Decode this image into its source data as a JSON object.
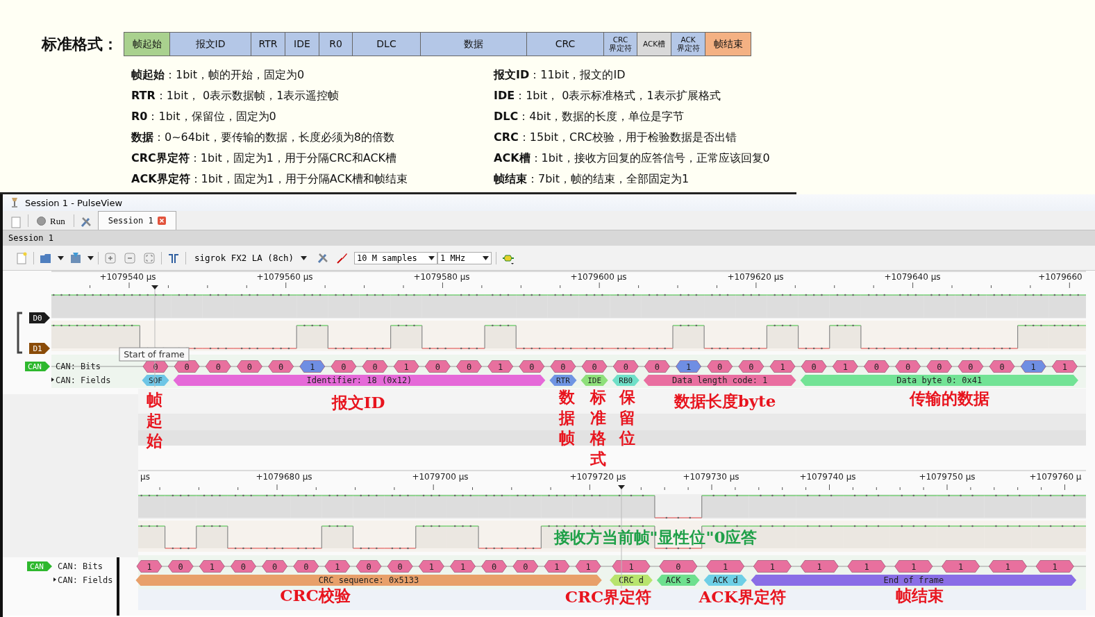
{
  "frame_format": {
    "title": "标准格式：",
    "fields": [
      {
        "lines": [
          "帧起始"
        ],
        "kind": "normal",
        "color": "#a9d18e"
      },
      {
        "lines": [
          "报文ID"
        ],
        "kind": "normal",
        "color": "#b4c7e7"
      },
      {
        "lines": [
          "RTR"
        ],
        "kind": "normal",
        "color": "#b4c7e7"
      },
      {
        "lines": [
          "IDE"
        ],
        "kind": "normal",
        "color": "#b4c7e7"
      },
      {
        "lines": [
          "R0"
        ],
        "kind": "normal",
        "color": "#b4c7e7"
      },
      {
        "lines": [
          "DLC"
        ],
        "kind": "normal",
        "color": "#b4c7e7"
      },
      {
        "lines": [
          "数据"
        ],
        "kind": "normal",
        "color": "#b4c7e7"
      },
      {
        "lines": [
          "CRC"
        ],
        "kind": "normal",
        "color": "#b4c7e7"
      },
      {
        "lines": [
          "CRC",
          "界定符"
        ],
        "kind": "small",
        "color": "#b4c7e7"
      },
      {
        "lines": [
          "ACK槽"
        ],
        "kind": "small",
        "color": "#d9d9d9"
      },
      {
        "lines": [
          "ACK",
          "界定符"
        ],
        "kind": "small",
        "color": "#b4c7e7"
      },
      {
        "lines": [
          "帧结束"
        ],
        "kind": "normal",
        "color": "#f4b183"
      }
    ],
    "descriptions": [
      {
        "left": "**帧起始**：1bit，帧的开始，固定为0",
        "right": "**报文ID**：11bit，报文的ID"
      },
      {
        "left": "**RTR**：1bit， 0表示数据帧，1表示遥控帧",
        "right": "**IDE**：1bit， 0表示标准格式，1表示扩展格式"
      },
      {
        "left": "**R0**：1bit，保留位，固定为0",
        "right": "**DLC**：4bit，数据的长度，单位是字节"
      },
      {
        "left": "**数据**：0~64bit，要传输的数据，长度必须为8的倍数",
        "right": "**CRC**：15bit，CRC校验，用于检验数据是否出错"
      },
      {
        "left": "**CRC界定符**：1bit，固定为1，用于分隔CRC和ACK槽",
        "right": "**ACK槽**：1bit，接收方回复的应答信号，正常应该回复0"
      },
      {
        "left": "**ACK界定符**：1bit，固定为1，用于分隔ACK槽和帧结束",
        "right": "**帧结束**：7bit，帧的结束，全部固定为1"
      }
    ]
  },
  "window": {
    "title": "Session 1 - PulseView",
    "run_label": "Run",
    "tabs": [
      {
        "label": "Session 1",
        "selected": true
      }
    ],
    "session_label": "Session 1",
    "toolbar": {
      "device": "sigrok FX2 LA (8ch)",
      "samples": "10 M samples",
      "rate": "1 MHz"
    }
  },
  "views": [
    {
      "ruler": [
        "+1079540 µs",
        "+1079560 µs",
        "+1079580 µs",
        "+1079600 µs",
        "+1079620 µs",
        "+1079640 µs",
        "+1079660"
      ],
      "channels": [
        {
          "label": "D0",
          "color": "#1c1c1c"
        },
        {
          "label": "D1",
          "color": "#8a4b08"
        }
      ],
      "decoder": {
        "label": "CAN",
        "rows": [
          "CAN: Bits",
          "CAN: Fields"
        ]
      },
      "leading_idle": true,
      "fields": [
        {
          "label": "SOF",
          "color": "#6ec6e6",
          "bits": [
            {
              "value": "0",
              "kind": "data"
            }
          ]
        },
        {
          "label": "Identifier: 18 (0x12)",
          "color": "#e56ad8",
          "bits": [
            {
              "value": "0",
              "kind": "data"
            },
            {
              "value": "0",
              "kind": "data"
            },
            {
              "value": "0",
              "kind": "data"
            },
            {
              "value": "0",
              "kind": "data"
            },
            {
              "value": "1",
              "kind": "stuff"
            },
            {
              "value": "0",
              "kind": "data"
            },
            {
              "value": "0",
              "kind": "data"
            },
            {
              "value": "1",
              "kind": "data"
            },
            {
              "value": "0",
              "kind": "data"
            },
            {
              "value": "0",
              "kind": "data"
            },
            {
              "value": "1",
              "kind": "data"
            },
            {
              "value": "0",
              "kind": "data"
            }
          ]
        },
        {
          "label": "RTR",
          "color": "#6f95e3",
          "bits": [
            {
              "value": "0",
              "kind": "data"
            }
          ]
        },
        {
          "label": "IDE",
          "color": "#8ee07a",
          "bits": [
            {
              "value": "0",
              "kind": "data"
            }
          ]
        },
        {
          "label": "RB0",
          "color": "#6fe0c8",
          "bits": [
            {
              "value": "0",
              "kind": "data"
            }
          ]
        },
        {
          "label": "Data length code: 1",
          "color": "#e96fa0",
          "bits": [
            {
              "value": "0",
              "kind": "data"
            },
            {
              "value": "1",
              "kind": "stuff"
            },
            {
              "value": "0",
              "kind": "data"
            },
            {
              "value": "0",
              "kind": "data"
            },
            {
              "value": "1",
              "kind": "data"
            }
          ]
        },
        {
          "label": "Data byte 0: 0x41",
          "color": "#72e395",
          "bits": [
            {
              "value": "0",
              "kind": "data"
            },
            {
              "value": "1",
              "kind": "data"
            },
            {
              "value": "0",
              "kind": "data"
            },
            {
              "value": "0",
              "kind": "data"
            },
            {
              "value": "0",
              "kind": "data"
            },
            {
              "value": "0",
              "kind": "data"
            },
            {
              "value": "0",
              "kind": "data"
            },
            {
              "value": "1",
              "kind": "stuff"
            },
            {
              "value": "1",
              "kind": "data"
            }
          ]
        }
      ]
    },
    {
      "ruler": [
        "µs",
        "+1079680 µs",
        "+1079700 µs",
        "+1079720 µs",
        "+1079730 µs",
        "+1079740 µs",
        "+1079750 µs",
        "+1079760 µ"
      ],
      "decoder": {
        "label": "CAN",
        "rows": [
          "CAN: Bits",
          "CAN: Fields"
        ]
      },
      "fields": [
        {
          "label": "CRC sequence: 0x5133",
          "color": "#e8a06a",
          "bits": [
            {
              "value": "1",
              "kind": "data"
            },
            {
              "value": "0",
              "kind": "data"
            },
            {
              "value": "1",
              "kind": "data"
            },
            {
              "value": "0",
              "kind": "data"
            },
            {
              "value": "0",
              "kind": "data"
            },
            {
              "value": "0",
              "kind": "data"
            },
            {
              "value": "1",
              "kind": "data"
            },
            {
              "value": "0",
              "kind": "data"
            },
            {
              "value": "0",
              "kind": "data"
            },
            {
              "value": "1",
              "kind": "data"
            },
            {
              "value": "1",
              "kind": "data"
            },
            {
              "value": "0",
              "kind": "data"
            },
            {
              "value": "0",
              "kind": "data"
            },
            {
              "value": "1",
              "kind": "data"
            },
            {
              "value": "1",
              "kind": "data"
            }
          ]
        },
        {
          "label": "CRC d",
          "color": "#b8e46e",
          "bits": [
            {
              "value": "1",
              "kind": "data"
            }
          ]
        },
        {
          "label": "ACK s",
          "color": "#6ee08e",
          "bits": [
            {
              "value": "0",
              "kind": "ack"
            }
          ]
        },
        {
          "label": "ACK d",
          "color": "#6ecfe6",
          "bits": [
            {
              "value": "1",
              "kind": "data"
            }
          ]
        },
        {
          "label": "End of frame",
          "color": "#8a6ee6",
          "bits": [
            {
              "value": "1",
              "kind": "data"
            },
            {
              "value": "1",
              "kind": "data"
            },
            {
              "value": "1",
              "kind": "data"
            },
            {
              "value": "1",
              "kind": "data"
            },
            {
              "value": "1",
              "kind": "data"
            },
            {
              "value": "1",
              "kind": "data"
            },
            {
              "value": "1",
              "kind": "data"
            }
          ]
        }
      ]
    }
  ],
  "tooltip": "Start of frame",
  "annotations": [
    {
      "text": "帧起始",
      "kind": "vertical",
      "color": "#e8141e"
    },
    {
      "text": "报文ID",
      "kind": "horizontal",
      "color": "#e8141e"
    },
    {
      "text": "数据帧",
      "kind": "vertical",
      "color": "#e8141e"
    },
    {
      "text": "标准格式",
      "kind": "vertical",
      "color": "#e8141e"
    },
    {
      "text": "保留位",
      "kind": "vertical",
      "color": "#e8141e"
    },
    {
      "text": "数据长度byte",
      "kind": "horizontal",
      "color": "#e8141e"
    },
    {
      "text": "传输的数据",
      "kind": "horizontal",
      "color": "#e8141e"
    },
    {
      "text": "接收方当前帧\"显性位\"0应答",
      "kind": "horizontal",
      "color": "#1fa048"
    },
    {
      "text": "CRC校验",
      "kind": "horizontal",
      "color": "#e8141e"
    },
    {
      "text": "CRC界定符",
      "kind": "horizontal",
      "color": "#e8141e"
    },
    {
      "text": "ACK界定符",
      "kind": "horizontal",
      "color": "#e8141e"
    },
    {
      "text": "帧结束",
      "kind": "horizontal",
      "color": "#e8141e"
    }
  ]
}
